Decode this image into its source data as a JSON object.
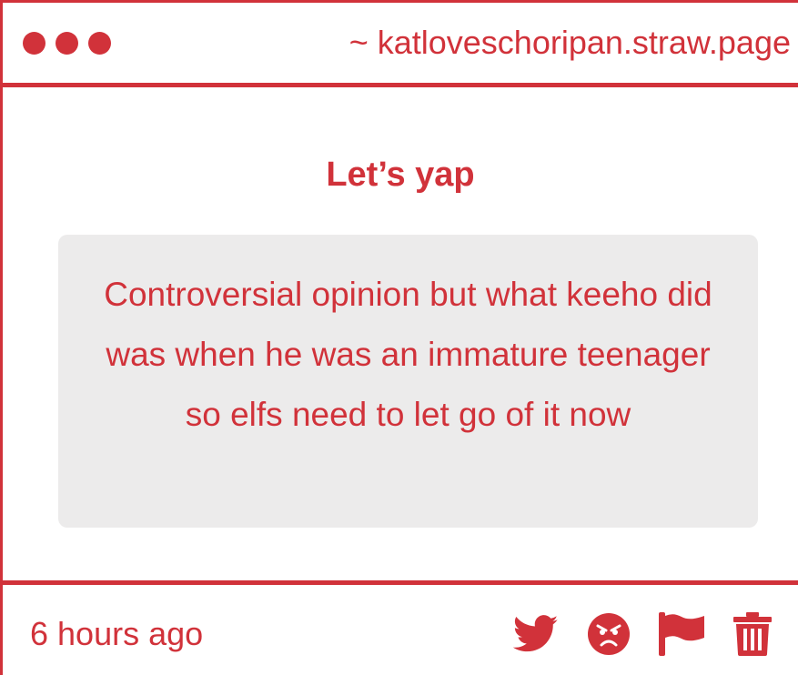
{
  "window": {
    "url": "~ katloveschoripan.straw.page"
  },
  "post": {
    "title": "Let’s yap",
    "body": "Controversial opinion but what keeho did was when he was an immature teenager so elfs need to let go of it now",
    "timestamp": "6 hours ago"
  },
  "icons": {
    "window_dots": [
      "dot-icon",
      "dot-icon",
      "dot-icon"
    ],
    "actions": [
      "twitter-icon",
      "angry-face-icon",
      "flag-icon",
      "trash-icon"
    ]
  },
  "colors": {
    "accent": "#d1323a",
    "card_background": "#ecebeb",
    "page_background": "#ffffff"
  }
}
